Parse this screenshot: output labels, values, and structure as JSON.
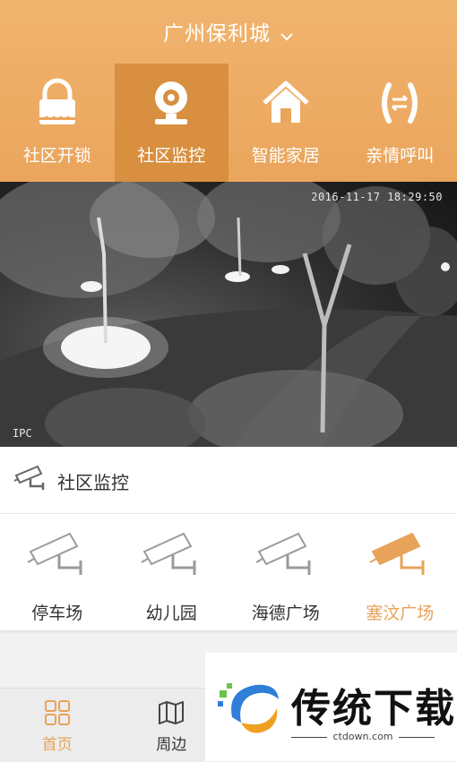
{
  "header": {
    "city": "广州保利城"
  },
  "nav": [
    {
      "label": "社区开锁",
      "icon": "lock-icon",
      "active": false
    },
    {
      "label": "社区监控",
      "icon": "webcam-icon",
      "active": true
    },
    {
      "label": "智能家居",
      "icon": "home-icon",
      "active": false
    },
    {
      "label": "亲情呼叫",
      "icon": "call-icon",
      "active": false
    }
  ],
  "feed": {
    "timestamp": "2016-11-17 18:29:50",
    "source": "IPC"
  },
  "section": {
    "title": "社区监控",
    "icon": "cctv-camera-icon"
  },
  "cameras": [
    {
      "label": "停车场",
      "active": false
    },
    {
      "label": "幼儿园",
      "active": false
    },
    {
      "label": "海德广场",
      "active": false
    },
    {
      "label": "塞汶广场",
      "active": true
    }
  ],
  "tabbar": [
    {
      "label": "首页",
      "icon": "home-grid-icon",
      "active": true
    },
    {
      "label": "周边",
      "icon": "map-icon",
      "active": false
    }
  ],
  "watermark": {
    "brand": "传统下载",
    "url": "ctdown.com"
  },
  "colors": {
    "accent": "#e8a35b",
    "header": "#eea860",
    "active_nav": "#d88f3f"
  }
}
